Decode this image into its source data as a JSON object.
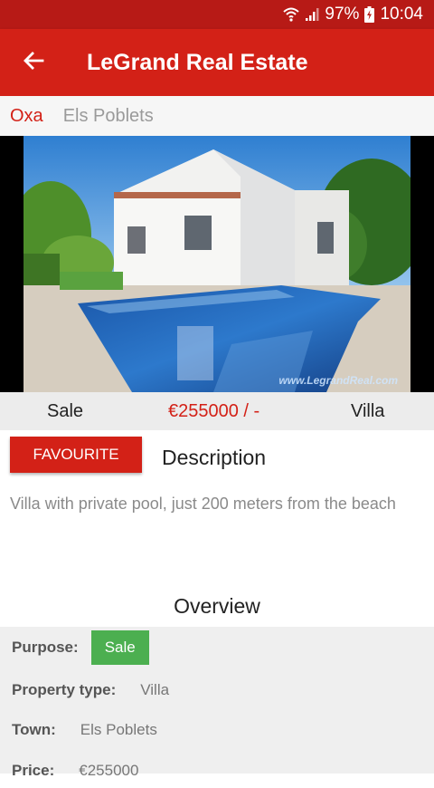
{
  "status_bar": {
    "battery": "97%",
    "time": "10:04"
  },
  "app_bar": {
    "title": "LeGrand Real Estate"
  },
  "breadcrumb": {
    "area": "Oxa",
    "town": "Els Poblets"
  },
  "photo": {
    "watermark": "www.LegrandReal.com"
  },
  "summary": {
    "operation": "Sale",
    "price": "€255000 / -",
    "type": "Villa"
  },
  "actions": {
    "favourite_label": "FAVOURITE"
  },
  "description": {
    "title": "Description",
    "text": "Villa with private pool, just 200 meters from the beach"
  },
  "overview": {
    "title": "Overview",
    "purpose_label": "Purpose:",
    "purpose_value": "Sale",
    "property_type_label": "Property type:",
    "property_type_value": "Villa",
    "town_label": "Town:",
    "town_value": "Els Poblets",
    "price_label": "Price:",
    "price_value": "€255000"
  },
  "colors": {
    "primary": "#d32117",
    "primary_dark": "#b71a16",
    "badge_green": "#4caf50"
  }
}
